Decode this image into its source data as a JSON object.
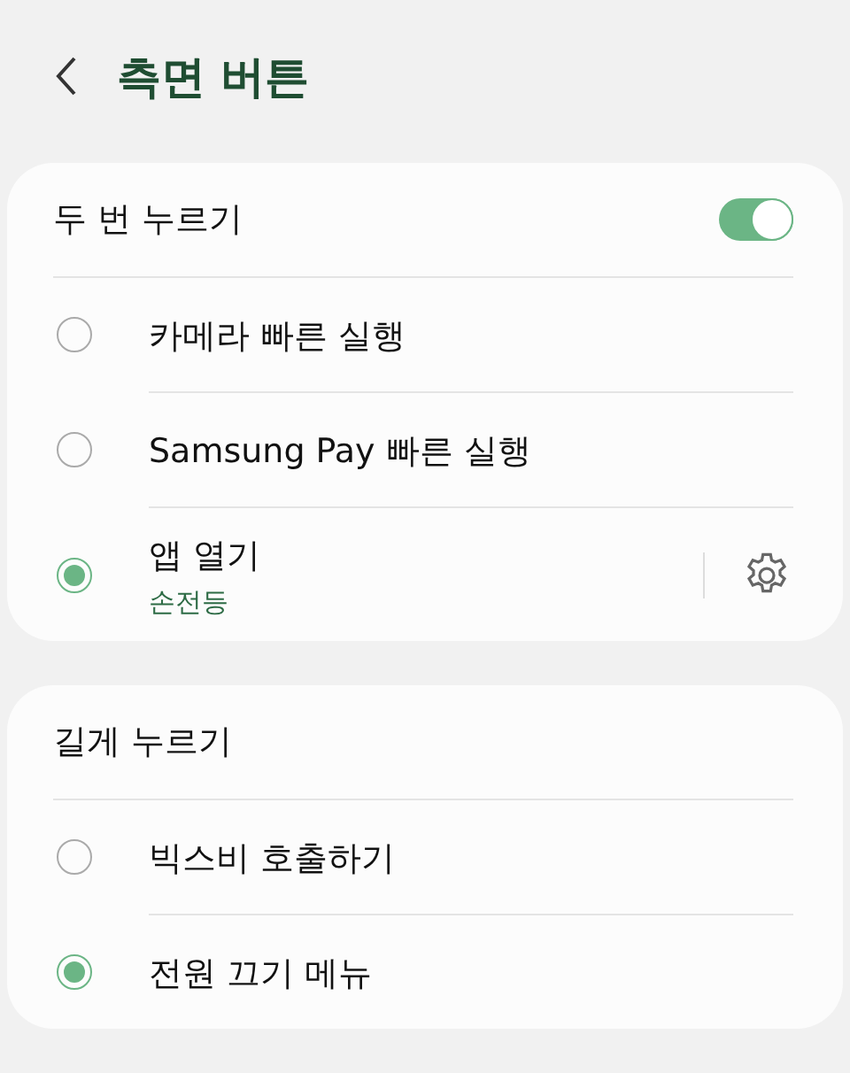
{
  "header": {
    "title": "측면 버튼"
  },
  "sections": [
    {
      "title": "두 번 누르기",
      "toggle": {
        "on": true
      },
      "options": [
        {
          "kind": "plain",
          "label": "카메라 빠른 실행",
          "selected": false
        },
        {
          "kind": "plain",
          "label": "Samsung Pay 빠른 실행",
          "selected": false
        },
        {
          "kind": "settings",
          "label": "앱 열기",
          "subtitle": "손전등",
          "selected": true
        }
      ]
    },
    {
      "title": "길게 누르기",
      "options": [
        {
          "kind": "plain",
          "label": "빅스비 호출하기",
          "selected": false
        },
        {
          "kind": "plain",
          "label": "전원 끄기 메뉴",
          "selected": true
        }
      ]
    }
  ]
}
